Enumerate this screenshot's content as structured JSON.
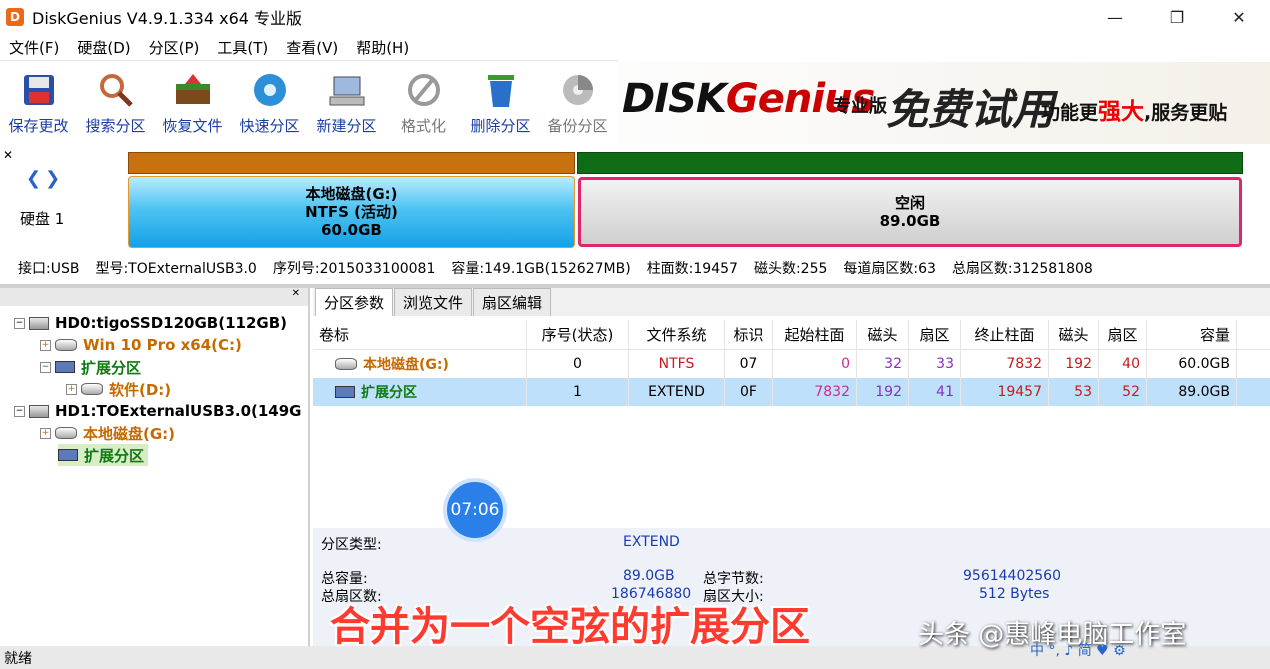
{
  "window": {
    "title": "DiskGenius V4.9.1.334 x64 专业版",
    "app_icon_letter": "D"
  },
  "menu": [
    "文件(F)",
    "硬盘(D)",
    "分区(P)",
    "工具(T)",
    "查看(V)",
    "帮助(H)"
  ],
  "toolbar": [
    {
      "label": "保存更改",
      "icon": "save-icon",
      "enabled": true
    },
    {
      "label": "搜索分区",
      "icon": "magnifier-icon",
      "enabled": true
    },
    {
      "label": "恢复文件",
      "icon": "recover-box-icon",
      "enabled": true
    },
    {
      "label": "快速分区",
      "icon": "disk-quick-icon",
      "enabled": true
    },
    {
      "label": "新建分区",
      "icon": "new-partition-icon",
      "enabled": true
    },
    {
      "label": "格式化",
      "icon": "format-icon",
      "enabled": false
    },
    {
      "label": "删除分区",
      "icon": "trash-icon",
      "enabled": true
    },
    {
      "label": "备份分区",
      "icon": "backup-icon",
      "enabled": false
    }
  ],
  "banner": {
    "logo_prefix": "DISK",
    "logo_suffix": "Genius",
    "edition": "专业版",
    "free": "免费试用",
    "slogan_a": "功能更",
    "slogan_hl": "强大",
    "slogan_b": ",服务更贴"
  },
  "diskmap": {
    "disk_label": "硬盘 1",
    "partition1": {
      "name": "本地磁盘(G:)",
      "fs": "NTFS (活动)",
      "size": "60.0GB"
    },
    "free": {
      "name": "空闲",
      "size": "89.0GB"
    }
  },
  "diskinfo": {
    "interface": "接口:USB",
    "model": "型号:TOExternalUSB3.0",
    "serial": "序列号:2015033100081",
    "capacity": "容量:149.1GB(152627MB)",
    "cylinders": "柱面数:19457",
    "heads": "磁头数:255",
    "sectors_per_track": "每道扇区数:63",
    "total_sectors": "总扇区数:312581808"
  },
  "tree": [
    {
      "label": "HD0:tigoSSD120GB(112GB)",
      "color": "black",
      "icon": "disk-icon",
      "exp": "−"
    },
    {
      "label": "Win 10 Pro x64(C:)",
      "color": "orange",
      "icon": "partition-icon",
      "exp": "+"
    },
    {
      "label": "扩展分区",
      "color": "green",
      "icon": "extended-icon",
      "exp": "−"
    },
    {
      "label": "软件(D:)",
      "color": "orange",
      "icon": "partition-icon",
      "exp": "+"
    },
    {
      "label": "HD1:TOExternalUSB3.0(149G",
      "color": "black",
      "icon": "disk-icon",
      "exp": "−"
    },
    {
      "label": "本地磁盘(G:)",
      "color": "orange",
      "icon": "partition-icon",
      "exp": "+"
    },
    {
      "label": "扩展分区",
      "color": "green",
      "icon": "extended-icon",
      "exp": ""
    }
  ],
  "tabs": [
    "分区参数",
    "浏览文件",
    "扇区编辑"
  ],
  "table": {
    "headers": [
      "卷标",
      "序号(状态)",
      "文件系统",
      "标识",
      "起始柱面",
      "磁头",
      "扇区",
      "终止柱面",
      "磁头",
      "扇区",
      "容量"
    ],
    "rows": [
      [
        "本地磁盘(G:)",
        "0",
        "NTFS",
        "07",
        "0",
        "32",
        "33",
        "7832",
        "192",
        "40",
        "60.0GB"
      ],
      [
        "扩展分区",
        "1",
        "EXTEND",
        "0F",
        "7832",
        "192",
        "41",
        "19457",
        "53",
        "52",
        "89.0GB"
      ]
    ]
  },
  "details": {
    "type_label": "分区类型:",
    "type_value": "EXTEND",
    "total_cap_label": "总容量:",
    "total_cap_value": "89.0GB",
    "total_bytes_label": "总字节数:",
    "total_bytes_value": "95614402560",
    "total_sectors_label": "总扇区数:",
    "total_sectors_value": "186746880",
    "sector_size_label": "扇区大小:",
    "sector_size_value": "512 Bytes"
  },
  "timer": "07:06",
  "status": "就绪",
  "caption": "合并为一个空弦的扩展分区",
  "watermark": "头条 @惠峰电脑工作室",
  "tray": "中 °, ♪ 简 ♥ ⚙"
}
